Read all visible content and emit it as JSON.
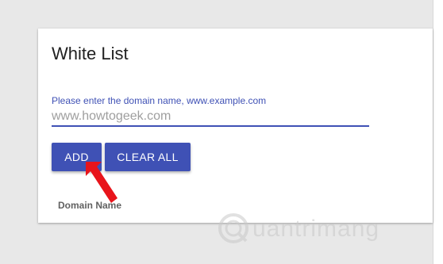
{
  "card": {
    "title": "White List",
    "domain_field": {
      "label": "Please enter the domain name, www.example.com",
      "value": "www.howtogeek.com"
    },
    "buttons": {
      "add_label": "ADD",
      "clear_all_label": "CLEAR ALL"
    },
    "table": {
      "column_header": "Domain Name"
    }
  },
  "annotation": {
    "arrow_icon": "red-arrow-icon",
    "arrow_color": "#e8141b"
  },
  "watermark": {
    "text": "uantrimang",
    "logo_icon": "quantrimang-logo-icon"
  },
  "colors": {
    "accent": "#3f51b5",
    "background": "#e8e8e8",
    "card": "#ffffff"
  }
}
